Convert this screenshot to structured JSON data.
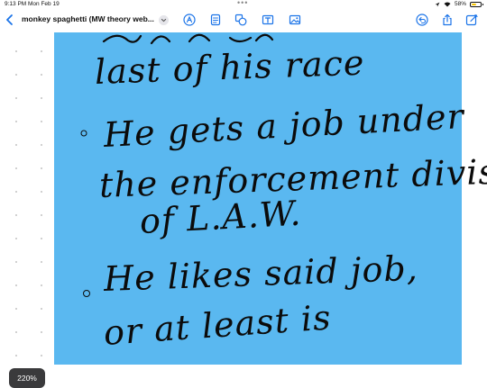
{
  "status_bar": {
    "time": "9:13 PM",
    "date": "Mon Feb 19",
    "battery": "58%",
    "battery_level": 0.58
  },
  "toolbar": {
    "title": "monkey spaghetti (MW theory web...",
    "icons": [
      "chevron-left",
      "chevron-down",
      "pencil",
      "document",
      "shapes",
      "text-box",
      "image",
      "undo",
      "share",
      "edit"
    ]
  },
  "note": {
    "background_color": "#5ab8f0",
    "ink_color": "#0b0b0b",
    "lines": [
      "last of his race",
      "He gets a job under",
      "the enforcement division",
      "of L.A.W.",
      "He likes said job,",
      "or at least is"
    ]
  },
  "zoom": {
    "label": "220%"
  }
}
